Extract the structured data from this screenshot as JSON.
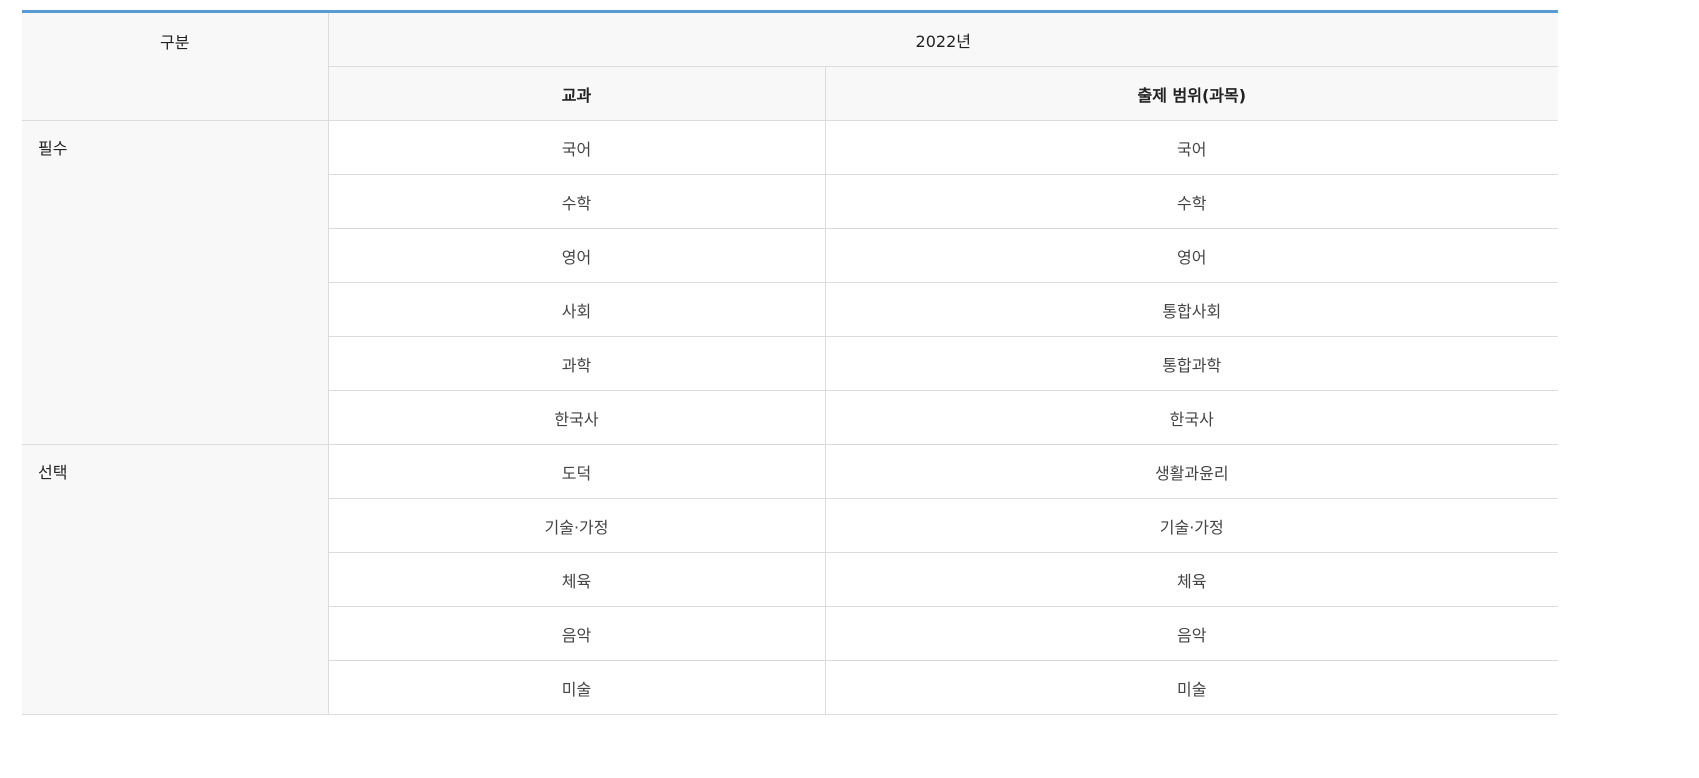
{
  "header": {
    "category": "구분",
    "year": "2022년",
    "subject": "교과",
    "scope": "출제 범위(과목)"
  },
  "groups": [
    {
      "label": "필수",
      "rows": [
        {
          "subject": "국어",
          "scope": "국어"
        },
        {
          "subject": "수학",
          "scope": "수학"
        },
        {
          "subject": "영어",
          "scope": "영어"
        },
        {
          "subject": "사회",
          "scope": "통합사회"
        },
        {
          "subject": "과학",
          "scope": "통합과학"
        },
        {
          "subject": "한국사",
          "scope": "한국사"
        }
      ]
    },
    {
      "label": "선택",
      "rows": [
        {
          "subject": "도덕",
          "scope": "생활과윤리"
        },
        {
          "subject": "기술·가정",
          "scope": "기술·가정"
        },
        {
          "subject": "체육",
          "scope": "체육"
        },
        {
          "subject": "음악",
          "scope": "음악"
        },
        {
          "subject": "미술",
          "scope": "미술"
        }
      ]
    }
  ],
  "colors": {
    "accent_top_border": "#5b9bd5",
    "header_background": "#f8f8f8",
    "grid_line": "#dcdcdc"
  }
}
